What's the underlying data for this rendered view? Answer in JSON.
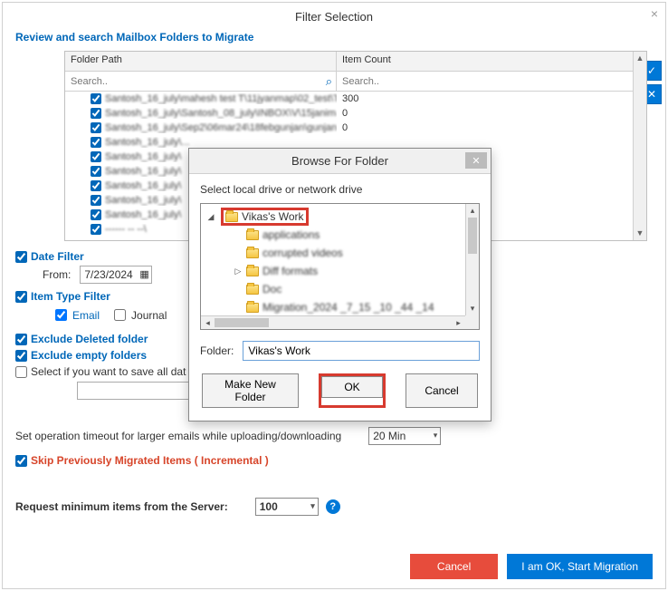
{
  "window": {
    "title": "Filter Selection",
    "close_x": "×"
  },
  "subtitle": "Review and search Mailbox Folders to Migrate",
  "grid": {
    "headers": {
      "path": "Folder Path",
      "count": "Item Count"
    },
    "search_placeholder": "Search..",
    "rows": [
      {
        "path": "Santosh_16_july\\mahesh test T\\11jyanmap\\02_test\\T...",
        "count": "300"
      },
      {
        "path": "Santosh_16_july\\Santosh_08_july\\INBOX\\V\\15janima...",
        "count": "0"
      },
      {
        "path": "Santosh_16_july\\Sep2\\06mar24\\18febgunjan\\gunjan...",
        "count": "0"
      },
      {
        "path": "Santosh_16_july\\...",
        "count": ""
      },
      {
        "path": "Santosh_16_july\\",
        "count": ""
      },
      {
        "path": "Santosh_16_july\\",
        "count": ""
      },
      {
        "path": "Santosh_16_july\\",
        "count": ""
      },
      {
        "path": "Santosh_16_july\\",
        "count": ""
      },
      {
        "path": "Santosh_16_july\\",
        "count": ""
      },
      {
        "path": "------ -- --\\",
        "count": ""
      }
    ]
  },
  "date_filter": {
    "label": "Date Filter",
    "from_label": "From:",
    "from_value": "7/23/2024"
  },
  "item_type": {
    "label": "Item Type Filter",
    "email": "Email",
    "journal": "Journal"
  },
  "exclude_deleted": "Exclude Deleted folder",
  "exclude_empty": "Exclude empty folders",
  "save_all": "Select if you want to save all dat",
  "timeout": {
    "label": "Set operation timeout for larger emails while uploading/downloading",
    "value": "20 Min"
  },
  "skip": "Skip Previously Migrated Items ( Incremental )",
  "request": {
    "label": "Request minimum items from the Server:",
    "value": "100"
  },
  "buttons": {
    "cancel": "Cancel",
    "ok": "I am OK, Start Migration"
  },
  "side": {
    "check": "✓",
    "x": "✕"
  },
  "browse": {
    "title": "Browse For Folder",
    "close": "✕",
    "sub": "Select local drive or network drive",
    "root": "Vikas's Work",
    "children": [
      {
        "label": "applications",
        "expander": ""
      },
      {
        "label": "corrupted videos",
        "expander": ""
      },
      {
        "label": "Diff formats",
        "expander": "▷"
      },
      {
        "label": "Doc",
        "expander": ""
      },
      {
        "label": "Migration_2024 _7_15 _10 _44 _14",
        "expander": ""
      }
    ],
    "folder_label": "Folder:",
    "folder_value": "Vikas's Work",
    "make_new": "Make New Folder",
    "ok": "OK",
    "cancel": "Cancel"
  }
}
